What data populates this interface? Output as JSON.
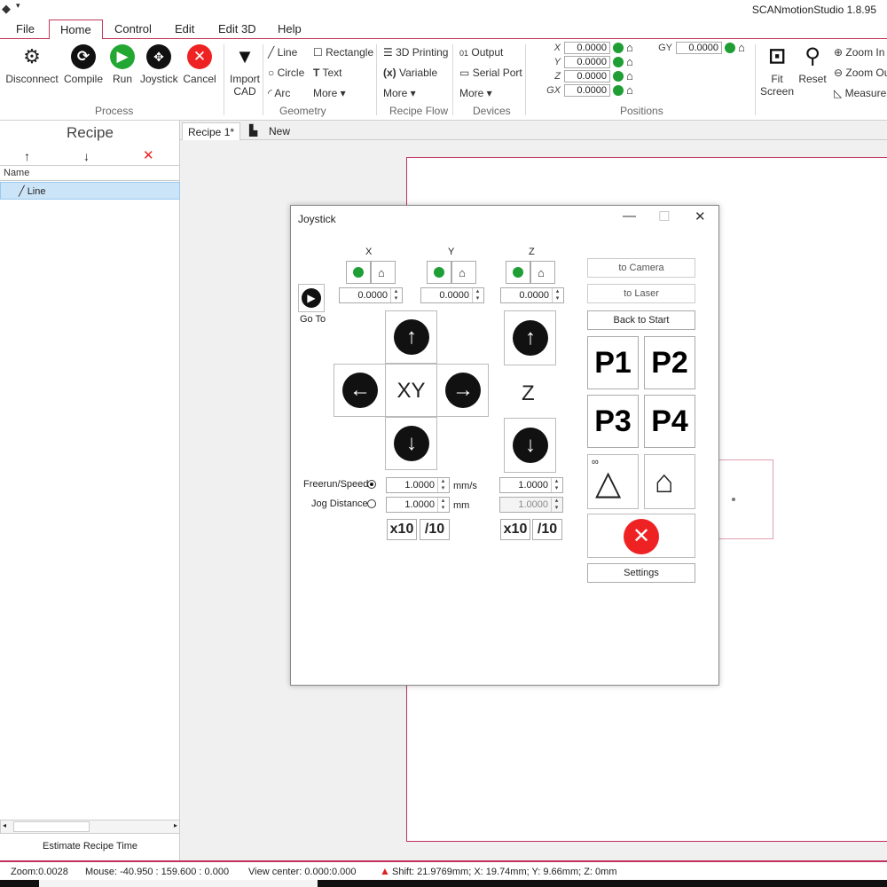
{
  "app": {
    "title": "SCANmotionStudio 1.8.95"
  },
  "menu": [
    "File",
    "Home",
    "Control",
    "Edit",
    "Edit 3D",
    "Help"
  ],
  "ribbon": {
    "process": {
      "label": "Process",
      "buttons": [
        "Disconnect",
        "Compile",
        "Run",
        "Joystick",
        "Cancel"
      ]
    },
    "import": {
      "line1": "Import",
      "line2": "CAD"
    },
    "geometry": {
      "label": "Geometry",
      "items": [
        "Line",
        "Rectangle",
        "Circle",
        "Text",
        "Arc",
        "More"
      ]
    },
    "recipe_flow": {
      "label": "Recipe Flow",
      "items": [
        "3D Printing",
        "Variable",
        "More"
      ]
    },
    "devices": {
      "label": "Devices",
      "items": [
        "Output",
        "Serial Port",
        "More"
      ]
    },
    "positions": {
      "label": "Positions",
      "rows": [
        {
          "axis": "X",
          "value": "0.0000"
        },
        {
          "axis": "Y",
          "value": "0.0000"
        },
        {
          "axis": "Z",
          "value": "0.0000"
        },
        {
          "axis": "GX",
          "value": "0.0000"
        }
      ],
      "gy": {
        "axis": "GY",
        "value": "0.0000"
      }
    },
    "view": {
      "fit_line1": "Fit",
      "fit_line2": "Screen",
      "reset": "Reset",
      "zoom_in": "Zoom In",
      "zoom_out": "Zoom Out",
      "measure": "Measure"
    }
  },
  "recipe_panel": {
    "title": "Recipe",
    "name_header": "Name",
    "items": [
      "Line"
    ],
    "estimate": "Estimate Recipe Time"
  },
  "tabs": {
    "recipe": "Recipe 1*",
    "new": "New"
  },
  "joystick": {
    "title": "Joystick",
    "axes": [
      {
        "name": "X",
        "value": "0.0000"
      },
      {
        "name": "Y",
        "value": "0.0000"
      },
      {
        "name": "Z",
        "value": "0.0000"
      }
    ],
    "goto": "Go To",
    "xy_label": "XY",
    "z_label": "Z",
    "freerun_label": "Freerun/Speed",
    "jog_label": "Jog Distance",
    "xy_speed": "1.0000",
    "xy_jog": "1.0000",
    "z_speed": "1.0000",
    "z_jog": "1.0000",
    "unit_speed": "mm/s",
    "unit_dist": "mm",
    "x10": "x10",
    "div10": "/10",
    "to_camera": "to Camera",
    "to_laser": "to Laser",
    "back_to_start": "Back to Start",
    "presets": [
      "P1",
      "P2",
      "P3",
      "P4"
    ],
    "settings": "Settings"
  },
  "status": {
    "zoom": "Zoom:0.0028",
    "mouse": "Mouse: -40.950 : 159.600 : 0.000",
    "view_center": "View center: 0.000:0.000",
    "shift": "Shift: 21.9769mm; X: 19.74mm; Y: 9.66mm; Z: 0mm"
  }
}
